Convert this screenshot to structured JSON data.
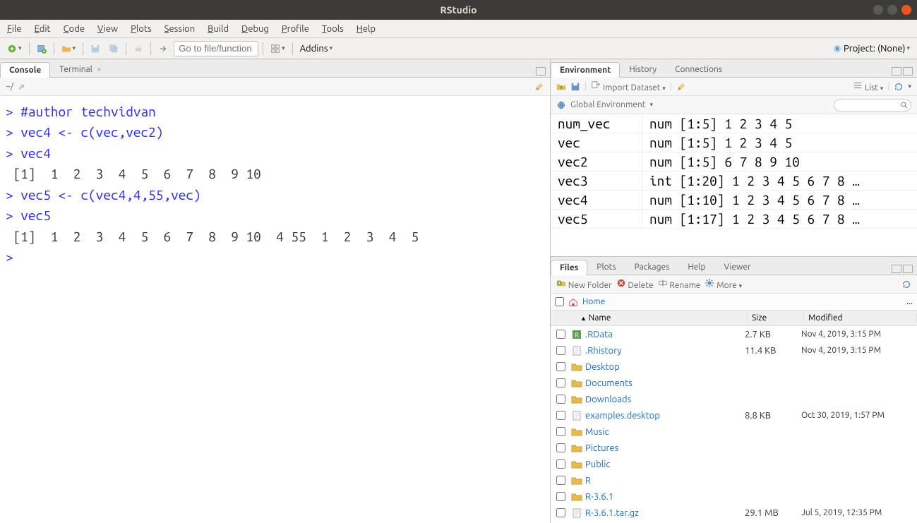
{
  "window": {
    "title": "RStudio"
  },
  "menu": [
    "File",
    "Edit",
    "Code",
    "View",
    "Plots",
    "Session",
    "Build",
    "Debug",
    "Profile",
    "Tools",
    "Help"
  ],
  "toolbar": {
    "goto_placeholder": "Go to file/function",
    "addins": "Addins",
    "project": "Project: (None)"
  },
  "left": {
    "tabs": {
      "console": "Console",
      "terminal": "Terminal"
    },
    "path": "~/",
    "console_lines": [
      {
        "t": "code",
        "text": "> #author techvidvan"
      },
      {
        "t": "code",
        "text": "> vec4 <- c(vec,vec2)"
      },
      {
        "t": "code",
        "text": "> vec4"
      },
      {
        "t": "out",
        "text": " [1]  1  2  3  4  5  6  7  8  9 10"
      },
      {
        "t": "code",
        "text": "> vec5 <- c(vec4,4,55,vec)"
      },
      {
        "t": "code",
        "text": "> vec5"
      },
      {
        "t": "out",
        "text": " [1]  1  2  3  4  5  6  7  8  9 10  4 55  1  2  3  4  5"
      },
      {
        "t": "code",
        "text": "> "
      }
    ]
  },
  "env": {
    "tabs": {
      "env": "Environment",
      "hist": "History",
      "conn": "Connections"
    },
    "import": "Import Dataset",
    "scope": "Global Environment",
    "view": "List",
    "vars": [
      {
        "name": "num_vec",
        "val": "num [1:5] 1 2 3 4 5"
      },
      {
        "name": "vec",
        "val": "num [1:5] 1 2 3 4 5"
      },
      {
        "name": "vec2",
        "val": "num [1:5] 6 7 8 9 10"
      },
      {
        "name": "vec3",
        "val": "int [1:20] 1 2 3 4 5 6 7 8 …"
      },
      {
        "name": "vec4",
        "val": "num [1:10] 1 2 3 4 5 6 7 8 …"
      },
      {
        "name": "vec5",
        "val": "num [1:17] 1 2 3 4 5 6 7 8 …"
      }
    ]
  },
  "files": {
    "tabs": {
      "files": "Files",
      "plots": "Plots",
      "pkg": "Packages",
      "help": "Help",
      "viewer": "Viewer"
    },
    "buttons": {
      "newfolder": "New Folder",
      "delete": "Delete",
      "rename": "Rename",
      "more": "More"
    },
    "breadcrumb": "Home",
    "cols": {
      "name": "Name",
      "size": "Size",
      "mod": "Modified"
    },
    "rows": [
      {
        "icon": "rdata",
        "name": ".RData",
        "size": "2.7 KB",
        "mod": "Nov 4, 2019, 3:15 PM"
      },
      {
        "icon": "file",
        "name": ".Rhistory",
        "size": "11.4 KB",
        "mod": "Nov 4, 2019, 3:15 PM"
      },
      {
        "icon": "folder",
        "name": "Desktop",
        "size": "",
        "mod": ""
      },
      {
        "icon": "folder",
        "name": "Documents",
        "size": "",
        "mod": ""
      },
      {
        "icon": "folder",
        "name": "Downloads",
        "size": "",
        "mod": ""
      },
      {
        "icon": "file",
        "name": "examples.desktop",
        "size": "8.8 KB",
        "mod": "Oct 30, 2019, 1:57 PM"
      },
      {
        "icon": "folder",
        "name": "Music",
        "size": "",
        "mod": ""
      },
      {
        "icon": "folder",
        "name": "Pictures",
        "size": "",
        "mod": ""
      },
      {
        "icon": "folder",
        "name": "Public",
        "size": "",
        "mod": ""
      },
      {
        "icon": "folder",
        "name": "R",
        "size": "",
        "mod": ""
      },
      {
        "icon": "folder",
        "name": "R-3.6.1",
        "size": "",
        "mod": ""
      },
      {
        "icon": "file",
        "name": "R-3.6.1.tar.gz",
        "size": "29.1 MB",
        "mod": "Jul 5, 2019, 12:35 PM"
      }
    ]
  }
}
